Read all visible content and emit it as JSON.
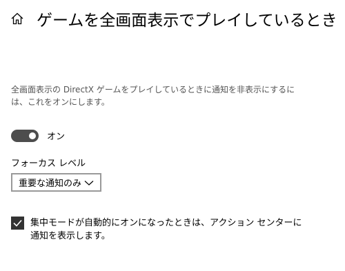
{
  "header": {
    "title": "ゲームを全画面表示でプレイしているとき",
    "home_icon": "home-icon"
  },
  "description": "全画面表示の DirectX ゲームをプレイしているときに通知を非表示にするには、これをオンにします。",
  "toggle": {
    "state": "on",
    "label": "オン"
  },
  "focus_level": {
    "label": "フォーカス レベル",
    "selected": "重要な通知のみ"
  },
  "checkbox": {
    "checked": true,
    "label": "集中モードが自動的にオンになったときは、アクション センターに通知を表示します。"
  },
  "colors": {
    "toggle_on": "#4d4d4d",
    "checkbox": "#333333",
    "description_text": "#555555",
    "dropdown_border": "#999999"
  }
}
